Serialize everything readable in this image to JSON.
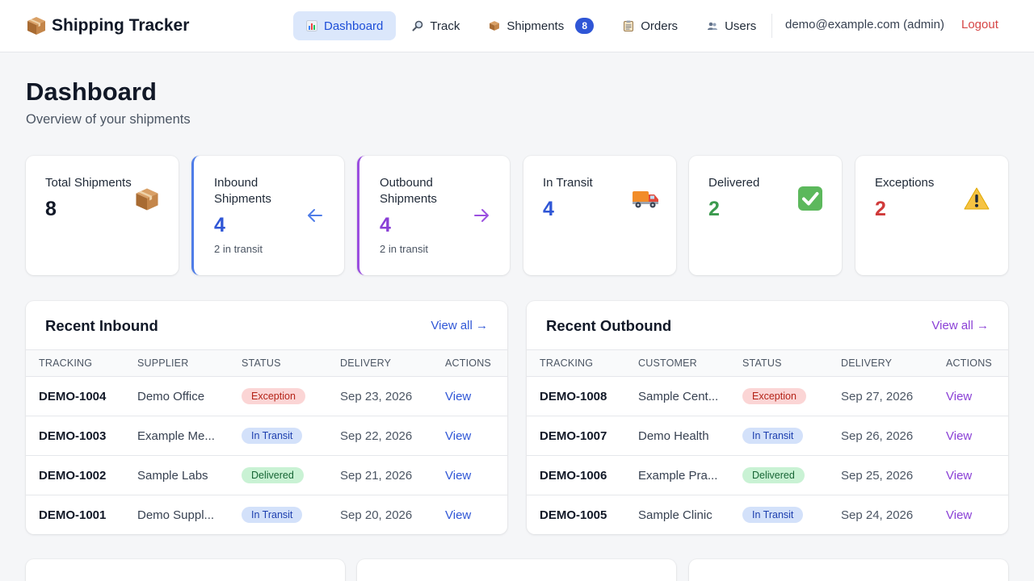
{
  "app": {
    "title": "Shipping Tracker",
    "logo_icon": "package-icon"
  },
  "nav": {
    "items": [
      {
        "label": "Dashboard",
        "icon": "bar-chart-icon",
        "active": true
      },
      {
        "label": "Track",
        "icon": "magnifier-icon"
      },
      {
        "label": "Shipments",
        "icon": "package-icon",
        "badge": "8"
      },
      {
        "label": "Orders",
        "icon": "clipboard-icon"
      },
      {
        "label": "Users",
        "icon": "users-icon"
      }
    ],
    "user": "demo@example.com (admin)",
    "logout": "Logout"
  },
  "page": {
    "title": "Dashboard",
    "subtitle": "Overview of your shipments"
  },
  "stats": [
    {
      "label": "Total Shipments",
      "value": "8",
      "icon": "package-icon",
      "color": "#111827"
    },
    {
      "label": "Inbound Shipments",
      "value": "4",
      "sub": "2 in transit",
      "icon": "arrow-left-icon",
      "color": "#2f56d6",
      "accent": "#4f7de8"
    },
    {
      "label": "Outbound Shipments",
      "value": "4",
      "sub": "2 in transit",
      "icon": "arrow-right-icon",
      "color": "#8a3fd6",
      "accent": "#9b4fe0"
    },
    {
      "label": "In Transit",
      "value": "4",
      "icon": "truck-icon",
      "color": "#2f56d6"
    },
    {
      "label": "Delivered",
      "value": "2",
      "icon": "check-box-icon",
      "color": "#3b9a4e"
    },
    {
      "label": "Exceptions",
      "value": "2",
      "icon": "warning-icon",
      "color": "#d03a3a"
    }
  ],
  "inbound": {
    "title": "Recent Inbound",
    "link": "View all →",
    "link_color": "#2f56d6",
    "columns": [
      "Tracking",
      "Supplier",
      "Status",
      "Delivery",
      "Actions"
    ],
    "rows": [
      {
        "tracking": "DEMO-1004",
        "party": "Demo Office",
        "status": "Exception",
        "delivery": "Sep 23, 2026",
        "action": "View"
      },
      {
        "tracking": "DEMO-1003",
        "party": "Example Me...",
        "status": "In Transit",
        "delivery": "Sep 22, 2026",
        "action": "View"
      },
      {
        "tracking": "DEMO-1002",
        "party": "Sample Labs",
        "status": "Delivered",
        "delivery": "Sep 21, 2026",
        "action": "View"
      },
      {
        "tracking": "DEMO-1001",
        "party": "Demo Suppl...",
        "status": "In Transit",
        "delivery": "Sep 20, 2026",
        "action": "View"
      }
    ]
  },
  "outbound": {
    "title": "Recent Outbound",
    "link": "View all →",
    "link_color": "#8a3fd6",
    "columns": [
      "Tracking",
      "Customer",
      "Status",
      "Delivery",
      "Actions"
    ],
    "rows": [
      {
        "tracking": "DEMO-1008",
        "party": "Sample Cent...",
        "status": "Exception",
        "delivery": "Sep 27, 2026",
        "action": "View"
      },
      {
        "tracking": "DEMO-1007",
        "party": "Demo Health",
        "status": "In Transit",
        "delivery": "Sep 26, 2026",
        "action": "View"
      },
      {
        "tracking": "DEMO-1006",
        "party": "Example Pra...",
        "status": "Delivered",
        "delivery": "Sep 25, 2026",
        "action": "View"
      },
      {
        "tracking": "DEMO-1005",
        "party": "Sample Clinic",
        "status": "In Transit",
        "delivery": "Sep 24, 2026",
        "action": "View"
      }
    ]
  }
}
